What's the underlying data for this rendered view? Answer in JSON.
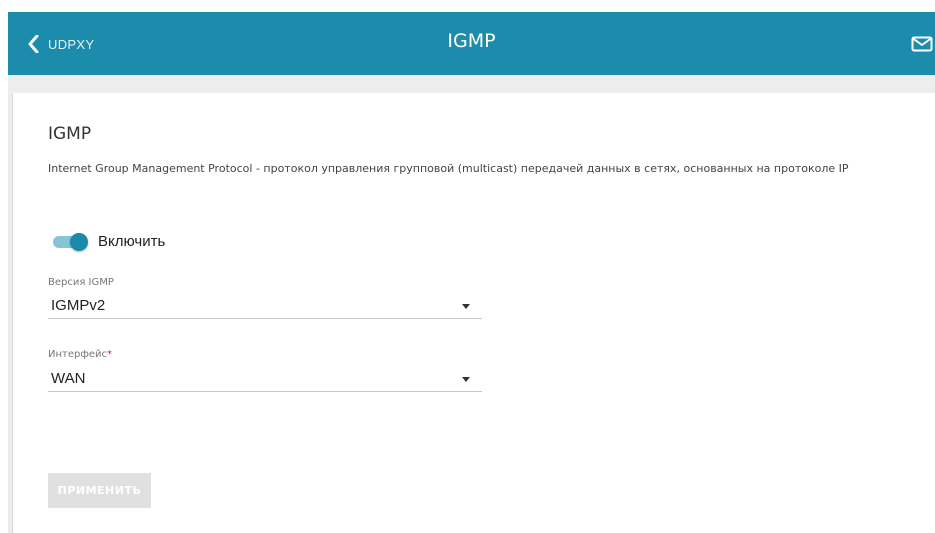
{
  "header": {
    "back_label": "UDPXY",
    "title": "IGMP",
    "icons": {
      "back": "chevron-left-icon",
      "mail": "mail-icon"
    },
    "background_color": "#1b8cab"
  },
  "section": {
    "title": "IGMP",
    "description": "Internet Group Management Protocol - протокол управления групповой (multicast) передачей данных в сетях, основанных на протоколе IP"
  },
  "enable_toggle": {
    "label": "Включить",
    "checked": true,
    "accent_color": "#1a89aa"
  },
  "igmp_version": {
    "label": "Версия IGMP",
    "value": "IGMPv2"
  },
  "interface": {
    "label": "Интерфейс",
    "required_mark": "*",
    "value": "WAN"
  },
  "apply_button": {
    "label": "ПРИМЕНИТЬ",
    "disabled": true
  }
}
